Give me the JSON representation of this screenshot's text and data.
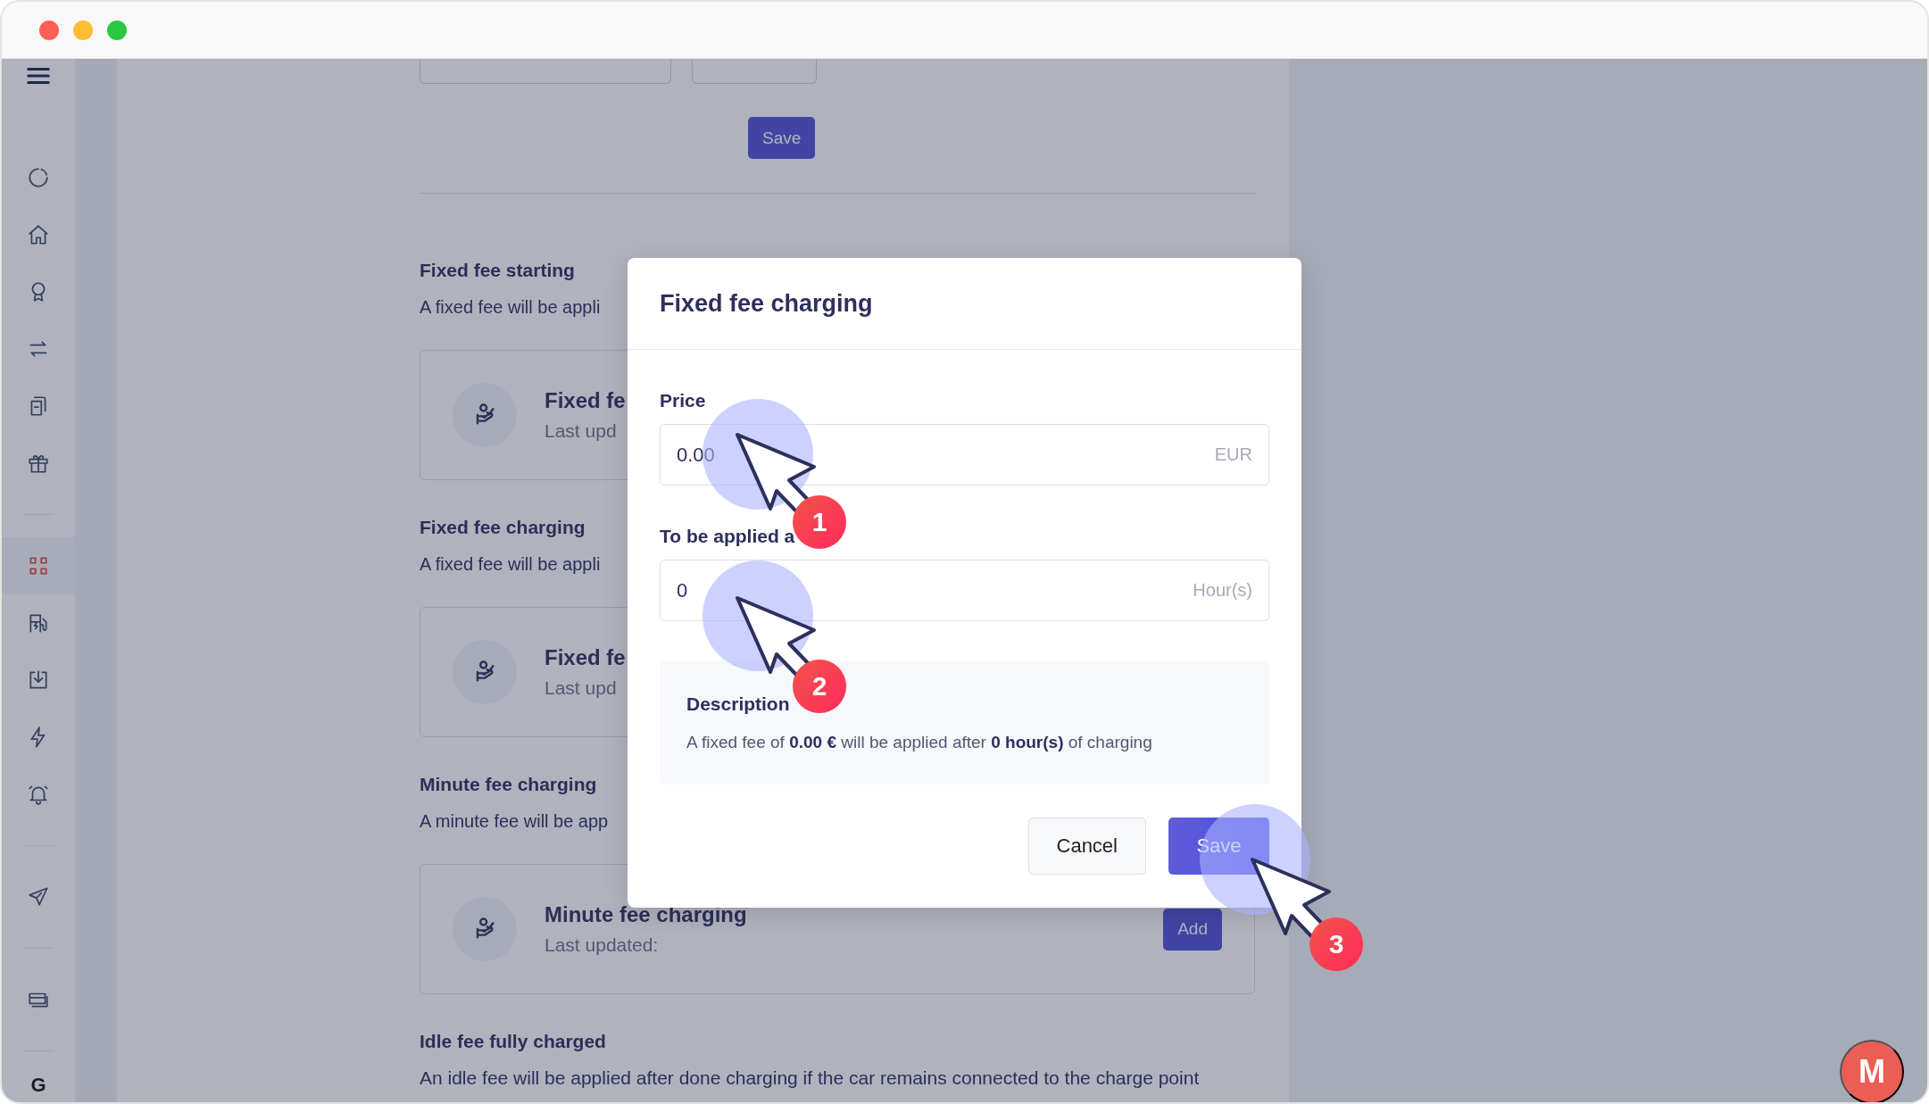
{
  "sidebar": {
    "groups": [
      [
        {
          "selected": false
        },
        {
          "selected": false
        },
        {
          "selected": false
        },
        {
          "selected": false
        },
        {
          "selected": false
        },
        {
          "selected": false
        }
      ],
      [
        {
          "selected": true
        },
        {
          "selected": false
        },
        {
          "selected": false
        },
        {
          "selected": false
        },
        {
          "selected": false
        }
      ],
      [
        {
          "selected": false
        }
      ],
      [
        {
          "selected": false
        }
      ]
    ],
    "footer_text": "G"
  },
  "page": {
    "save_button": "Save",
    "sections": [
      {
        "title": "Fixed fee starting",
        "description": "A fixed fee will be appli",
        "card": {
          "title": "Fixed fe",
          "subtitle": "Last upd"
        }
      },
      {
        "title": "Fixed fee charging",
        "description": "A fixed fee will be appli",
        "card": {
          "title": "Fixed fe",
          "subtitle": "Last upd"
        }
      },
      {
        "title": "Minute fee charging",
        "description": "A minute fee will be app",
        "card": {
          "title": "Minute fee charging",
          "subtitle": "Last updated:",
          "button": "Add"
        }
      },
      {
        "title": "Idle fee fully charged",
        "description": "An idle fee will be applied after done charging if the car remains connected to the charge point"
      }
    ]
  },
  "modal": {
    "title": "Fixed fee charging",
    "fields": [
      {
        "label": "Price",
        "value": "0.00",
        "unit": "EUR",
        "step": "1"
      },
      {
        "label": "To be applied a",
        "value": "0",
        "unit": "Hour(s)",
        "step": "2"
      }
    ],
    "description": {
      "title": "Description",
      "text": "A fixed fee of **0.00 €** will be applied after **0 hour(s)** of charging"
    },
    "cancel_button": "Cancel",
    "save_button": {
      "label": "Save",
      "step": "3"
    }
  },
  "chat_button": {
    "label": "M"
  }
}
